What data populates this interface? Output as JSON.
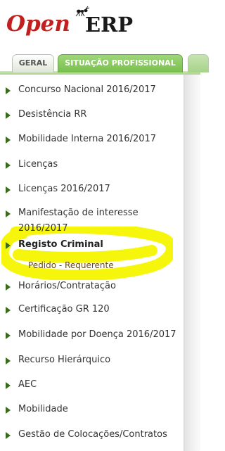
{
  "logo": {
    "open": "Open",
    "erp": "ERP"
  },
  "tabs": [
    {
      "label": "GERAL",
      "active": false
    },
    {
      "label": "SITUAÇÃO PROFISSIONAL",
      "active": true
    }
  ],
  "menu": {
    "items": [
      {
        "label": "Concurso Nacional 2016/2017"
      },
      {
        "label": "Desistência RR"
      },
      {
        "label": "Mobilidade Interna 2016/2017"
      },
      {
        "label": "Licenças"
      },
      {
        "label": "Licenças 2016/2017"
      },
      {
        "label": "Manifestação de interesse 2016/2017"
      },
      {
        "label": "Registo Criminal",
        "expanded": true,
        "children": [
          {
            "label": "Pedido - Requerente"
          }
        ]
      },
      {
        "label": "Horários/Contratação"
      },
      {
        "label": "Certificação GR 120"
      },
      {
        "label": "Mobilidade por Doença 2016/2017"
      },
      {
        "label": "Recurso Hierárquico"
      },
      {
        "label": "AEC"
      },
      {
        "label": "Mobilidade"
      },
      {
        "label": "Gestão de Colocações/Contratos"
      }
    ]
  },
  "colors": {
    "brand_red": "#c21f1f",
    "tab_active": "#78bf4c",
    "arrow": "#3a6b1c",
    "highlighter": "#f5f500"
  }
}
